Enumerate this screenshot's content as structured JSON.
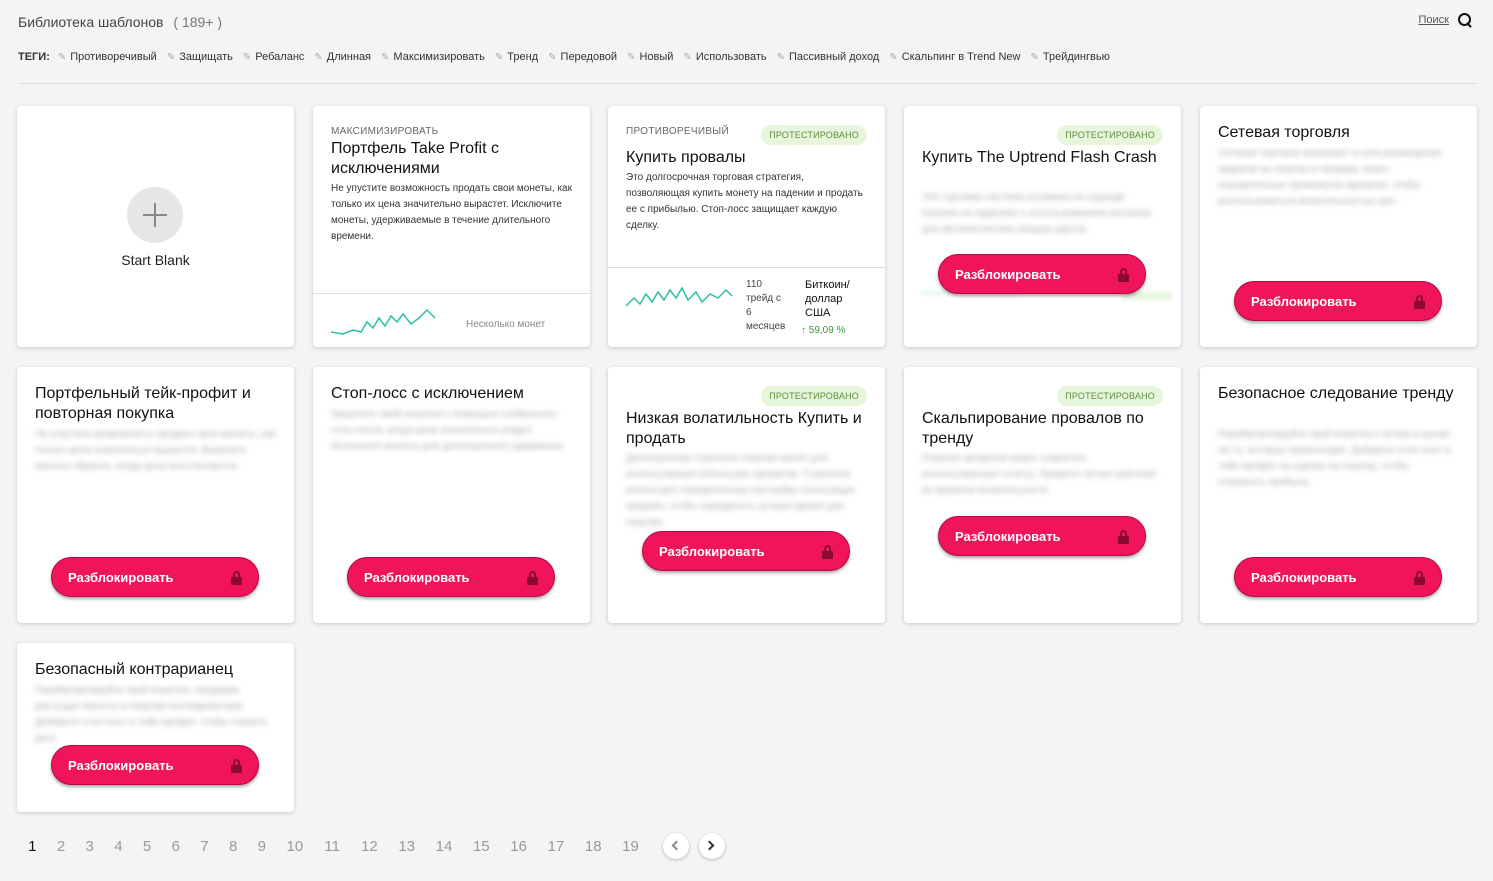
{
  "header": {
    "title": "Библиотека шаблонов",
    "count": "( 189+ )",
    "search_label": "Поиск"
  },
  "tags_label": "ТЕГИ:",
  "tags": [
    "Противоречивый",
    "Защищать",
    "Ребаланс",
    "Длинная",
    "Максимизировать",
    "Тренд",
    "Передовой",
    "Новый",
    "Использовать",
    "Пассивный доход",
    "Скальпинг в Trend New",
    "Трейдингвью"
  ],
  "unlock_label": "Разблокировать",
  "tested_label": "ПРОТЕСТИРОВАНО",
  "cards": {
    "blank": {
      "label": "Start Blank"
    },
    "c2": {
      "category": "МАКСИМИЗИРОВАТЬ",
      "title": "Портфель Take Profit с исключениями",
      "desc": "Не упустите возможность продать свои монеты, как только их цена значительно вырастет. Исключите монеты, удерживаемые в течение длительного времени.",
      "foot": "Несколько монет"
    },
    "c3": {
      "category": "ПРОТИВОРЕЧИВЫЙ",
      "title": "Купить провалы",
      "desc": "Это долгосрочная торговая стратегия, позволяющая купить монету на падении и продать ее с прибылью. Стоп-лосс защищает каждую сделку.",
      "trades": "110",
      "trades_label": "трейд с",
      "months": "6",
      "months_label": "месяцев",
      "pair": "Биткоин/доллар США",
      "profit": "↑ 59,09 %"
    },
    "c4": {
      "title": "Купить The Uptrend Flash Crash",
      "desc": "Эта торговая система основана на подходе покупки на падениях с использованием сигналов для автоматических входов сделок."
    },
    "c5": {
      "title": "Сетевая торговля",
      "desc": "Сетевая торговля возникает в сети размещения ордеров на покупку и продажу через определенные промежутки времени, чтобы воспользоваться волатильностью цен."
    },
    "c6": {
      "title": "Портфельный тейк-профит и повторная покупка",
      "desc": "Не упустите возможность продать свои монеты, как только цена значительно вырастет. Выкупите монеты обратно, когда цена восстановится."
    },
    "c7": {
      "title": "Стоп-лосс с исключением",
      "desc": "Защитите свой кошелек с помощью глобального стоп-лосса, когда цена значительно упадет. Исключите монеты для долгосрочного удержания."
    },
    "c8": {
      "title": "Низкая волатильность Купить и продать",
      "desc": "Долгосрочная стратегия покупки монет для использования небольших провалов. Стратегия использует определенную настройку скользящих средних, чтобы определить лучшее время для покупки."
    },
    "c9": {
      "title": "Скальпирование провалов по тренду",
      "desc": "Покупка провалов может сократить использованные отчеты. Правило лучше работает во времена волатильности."
    },
    "c10": {
      "title": "Безопасное следование тренду",
      "desc": "Перебалансируйте свой кошелек с всеми в рынке на то, которые превосходят. Добавьте стоп-лосс и тейк-профит на сделки на покупку, чтобы сохранить прибыль."
    },
    "c11": {
      "title": "Безопасный контрарианец",
      "desc": "Перебалансируйте свой кошелек, продавая растущие монеты и покупая контрарианские. Добавьте стоп-лосс и тейк-профит, чтобы снизить риск."
    }
  },
  "pagination": {
    "pages": [
      "1",
      "2",
      "3",
      "4",
      "5",
      "6",
      "7",
      "8",
      "9",
      "10",
      "11",
      "12",
      "13",
      "14",
      "15",
      "16",
      "17",
      "18",
      "19"
    ],
    "current": "1"
  }
}
